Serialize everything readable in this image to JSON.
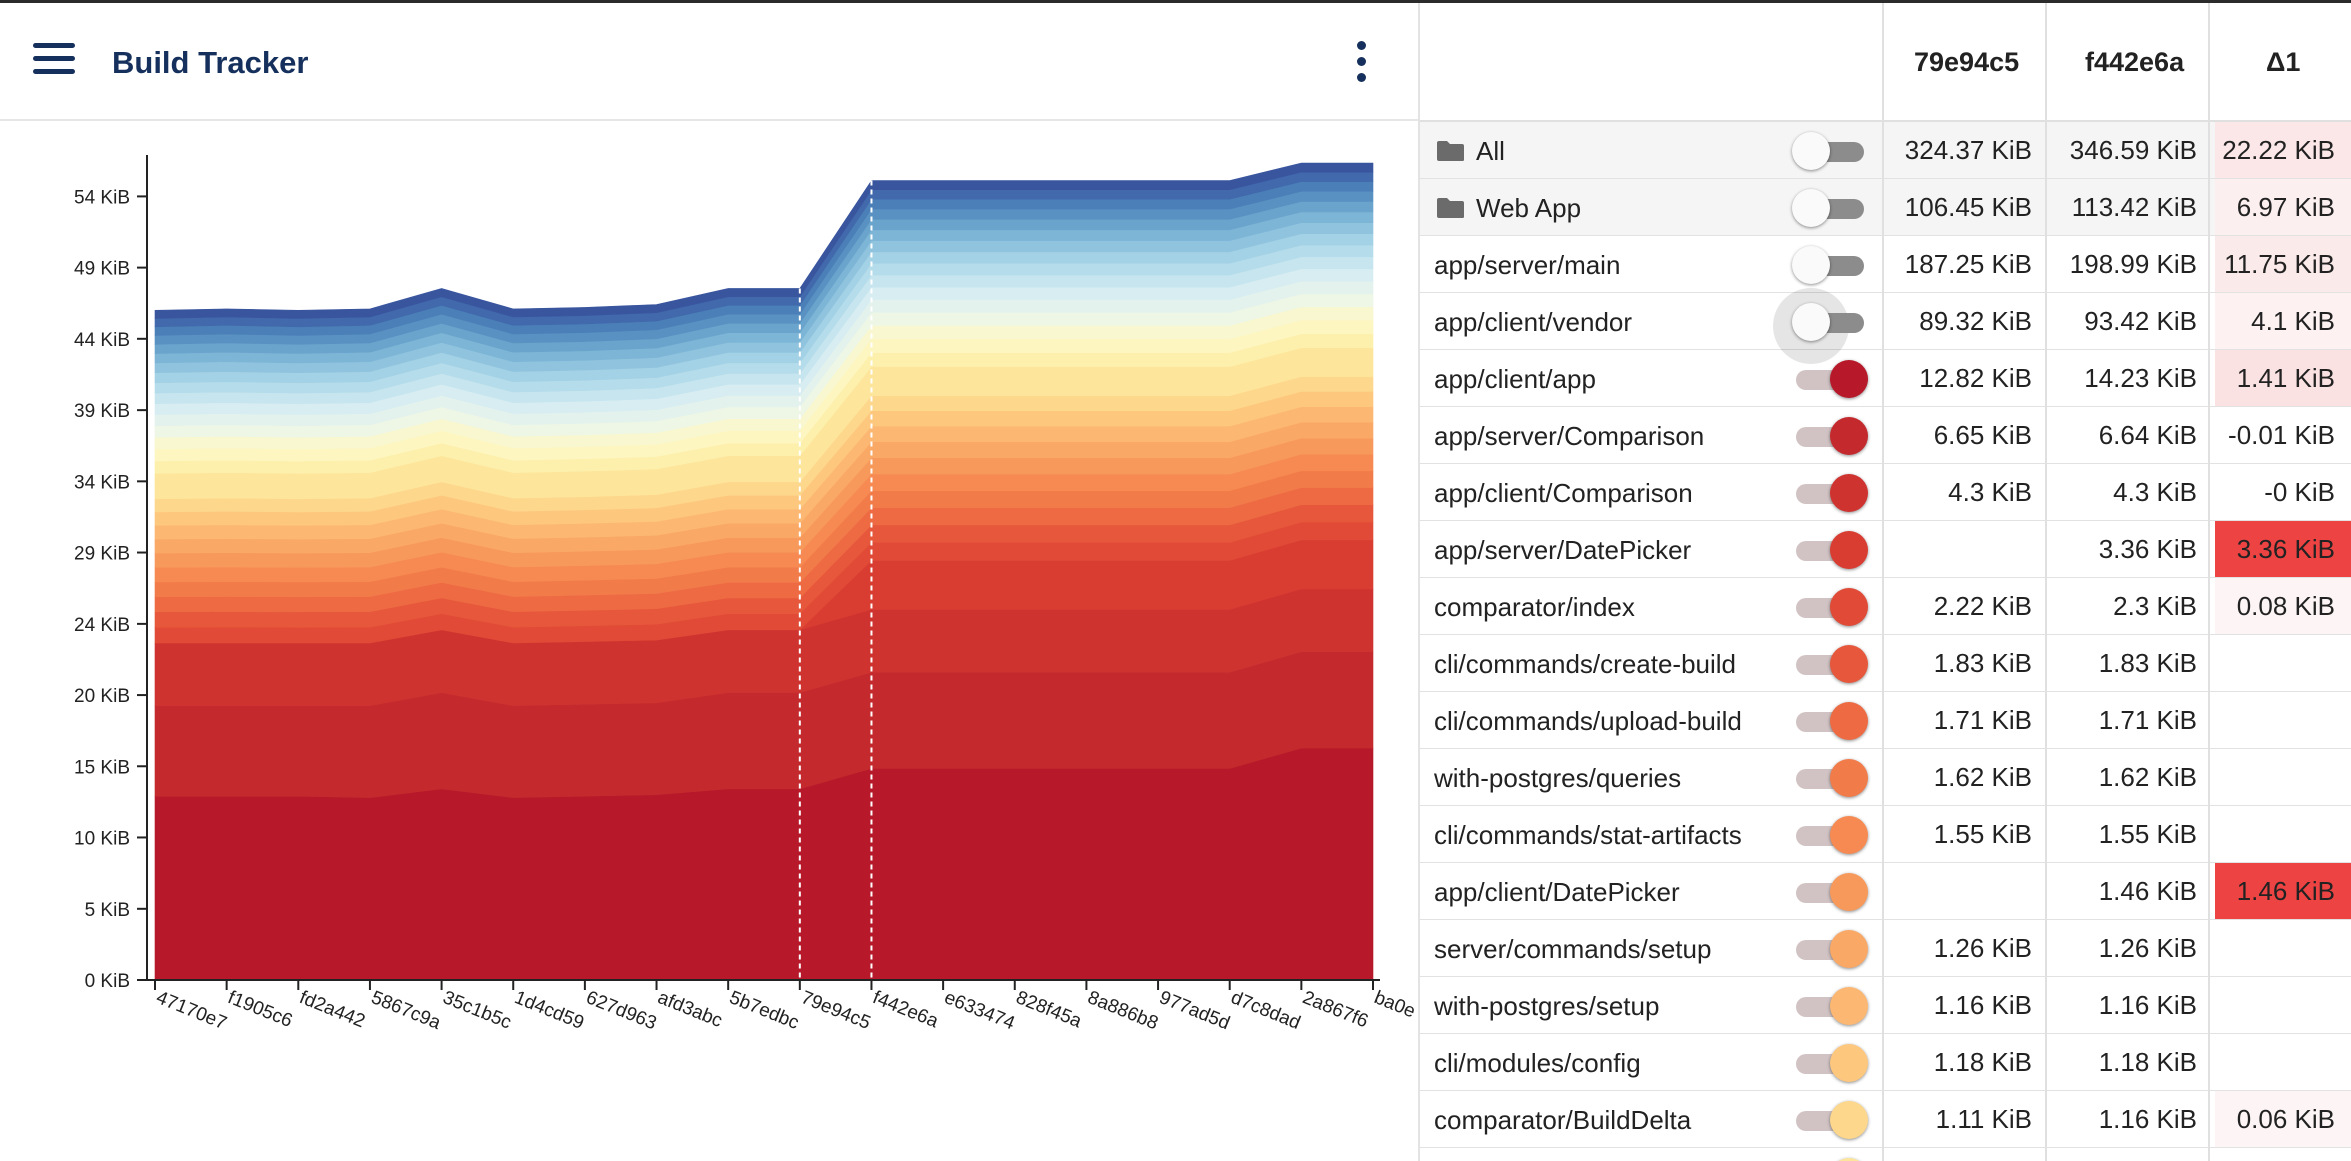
{
  "app": {
    "title": "Build Tracker"
  },
  "table": {
    "columns": [
      "79e94c5",
      "f442e6a",
      "Δ1"
    ],
    "rows": [
      {
        "name": "All",
        "group": true,
        "on": false,
        "v1": "324.37 KiB",
        "v2": "346.59 KiB",
        "d": "22.22 KiB",
        "dcolor": "#fbe7e7",
        "color": "#ffffff"
      },
      {
        "name": "Web App",
        "group": true,
        "on": false,
        "v1": "106.45 KiB",
        "v2": "113.42 KiB",
        "d": "6.97 KiB",
        "dcolor": "#fcefef",
        "color": "#ffffff"
      },
      {
        "name": "app/server/main",
        "on": false,
        "v1": "187.25 KiB",
        "v2": "198.99 KiB",
        "d": "11.75 KiB",
        "dcolor": "#fbeaea",
        "color": "#ffffff"
      },
      {
        "name": "app/client/vendor",
        "on": false,
        "halo": true,
        "v1": "89.32 KiB",
        "v2": "93.42 KiB",
        "d": "4.1 KiB",
        "dcolor": "#fdf1f1",
        "color": "#ffffff"
      },
      {
        "name": "app/client/app",
        "on": true,
        "v1": "12.82 KiB",
        "v2": "14.23 KiB",
        "d": "1.41 KiB",
        "dcolor": "#fbe2e2",
        "color": "#b7192a"
      },
      {
        "name": "app/server/Comparison",
        "on": true,
        "v1": "6.65 KiB",
        "v2": "6.64 KiB",
        "d": "-0.01 KiB",
        "dcolor": "",
        "color": "#c42a2d"
      },
      {
        "name": "app/client/Comparison",
        "on": true,
        "v1": "4.3 KiB",
        "v2": "4.3 KiB",
        "d": "-0 KiB",
        "dcolor": "",
        "color": "#cf3330"
      },
      {
        "name": "app/server/DatePicker",
        "on": true,
        "v1": "",
        "v2": "3.36 KiB",
        "d": "3.36 KiB",
        "dcolor": "#ee4343",
        "color": "#d93c31"
      },
      {
        "name": "comparator/index",
        "on": true,
        "v1": "2.22 KiB",
        "v2": "2.3 KiB",
        "d": "0.08 KiB",
        "dcolor": "#fdf5f5",
        "color": "#e04a36"
      },
      {
        "name": "cli/commands/create-build",
        "on": true,
        "v1": "1.83 KiB",
        "v2": "1.83 KiB",
        "d": "",
        "dcolor": "",
        "color": "#e6573b"
      },
      {
        "name": "cli/commands/upload-build",
        "on": true,
        "v1": "1.71 KiB",
        "v2": "1.71 KiB",
        "d": "",
        "dcolor": "",
        "color": "#ed6a43"
      },
      {
        "name": "with-postgres/queries",
        "on": true,
        "v1": "1.62 KiB",
        "v2": "1.62 KiB",
        "d": "",
        "dcolor": "",
        "color": "#f27b4a"
      },
      {
        "name": "cli/commands/stat-artifacts",
        "on": true,
        "v1": "1.55 KiB",
        "v2": "1.55 KiB",
        "d": "",
        "dcolor": "",
        "color": "#f68a52"
      },
      {
        "name": "app/client/DatePicker",
        "on": true,
        "v1": "",
        "v2": "1.46 KiB",
        "d": "1.46 KiB",
        "dcolor": "#ee4343",
        "color": "#f8995c"
      },
      {
        "name": "server/commands/setup",
        "on": true,
        "v1": "1.26 KiB",
        "v2": "1.26 KiB",
        "d": "",
        "dcolor": "",
        "color": "#faa866"
      },
      {
        "name": "with-postgres/setup",
        "on": true,
        "v1": "1.16 KiB",
        "v2": "1.16 KiB",
        "d": "",
        "dcolor": "",
        "color": "#fcb872"
      },
      {
        "name": "cli/modules/config",
        "on": true,
        "v1": "1.18 KiB",
        "v2": "1.18 KiB",
        "d": "",
        "dcolor": "",
        "color": "#fdc77e"
      },
      {
        "name": "comparator/BuildDelta",
        "on": true,
        "v1": "1.11 KiB",
        "v2": "1.16 KiB",
        "d": "0.06 KiB",
        "dcolor": "#fdf5f5",
        "color": "#fdd78c"
      },
      {
        "name": "",
        "on": true,
        "v1": "",
        "v2": "",
        "d": "",
        "dcolor": "",
        "color": "#fde69b"
      }
    ]
  },
  "chart_data": {
    "type": "area",
    "stacked": true,
    "x": [
      "47170e7",
      "f1905c6",
      "fd2a442",
      "5867c9a",
      "35c1b5c",
      "1d4cd59",
      "627d963",
      "afd3abc",
      "5b7edbc",
      "79e94c5",
      "f442e6a",
      "e633474",
      "828f45a",
      "8a886b8",
      "977ad5d",
      "d7c8dad",
      "2a867f6",
      "ba0e"
    ],
    "ylim": [
      0,
      56
    ],
    "yticks": [
      "0 KiB",
      "5 KiB",
      "10 KiB",
      "15 KiB",
      "20 KiB",
      "24 KiB",
      "29 KiB",
      "34 KiB",
      "39 KiB",
      "44 KiB",
      "49 KiB",
      "54 KiB"
    ],
    "ytick_values": [
      0,
      4.88,
      9.77,
      14.65,
      19.53,
      24.41,
      29.3,
      34.18,
      39.06,
      43.95,
      48.83,
      53.71
    ],
    "highlighted": [
      "79e94c5",
      "f442e6a"
    ],
    "grid": false,
    "totals": [
      45.9,
      46.0,
      45.9,
      46.0,
      47.4,
      46.0,
      46.1,
      46.3,
      47.4,
      47.4,
      54.8,
      54.8,
      54.8,
      54.8,
      54.8,
      54.8,
      56.0,
      56.0
    ],
    "series": [
      {
        "values": [
          12.6,
          12.6,
          12.6,
          12.5,
          13.1,
          12.5,
          12.6,
          12.7,
          13.1,
          13.1,
          14.5,
          14.5,
          14.5,
          14.5,
          14.5,
          14.5,
          15.9,
          15.9
        ]
      },
      {
        "values": [
          6.2,
          6.2,
          6.2,
          6.3,
          6.6,
          6.3,
          6.3,
          6.3,
          6.6,
          6.6,
          6.6,
          6.6,
          6.6,
          6.6,
          6.6,
          6.6,
          6.6,
          6.6
        ]
      },
      {
        "values": [
          4.3,
          4.3,
          4.3,
          4.3,
          4.3,
          4.3,
          4.3,
          4.3,
          4.3,
          4.3,
          4.3,
          4.3,
          4.3,
          4.3,
          4.3,
          4.3,
          4.3,
          4.3
        ]
      },
      {
        "values": [
          0,
          0,
          0,
          0,
          0,
          0,
          0,
          0,
          0,
          0,
          3.36,
          3.36,
          3.36,
          3.36,
          3.36,
          3.36,
          3.36,
          3.36
        ]
      }
    ]
  }
}
